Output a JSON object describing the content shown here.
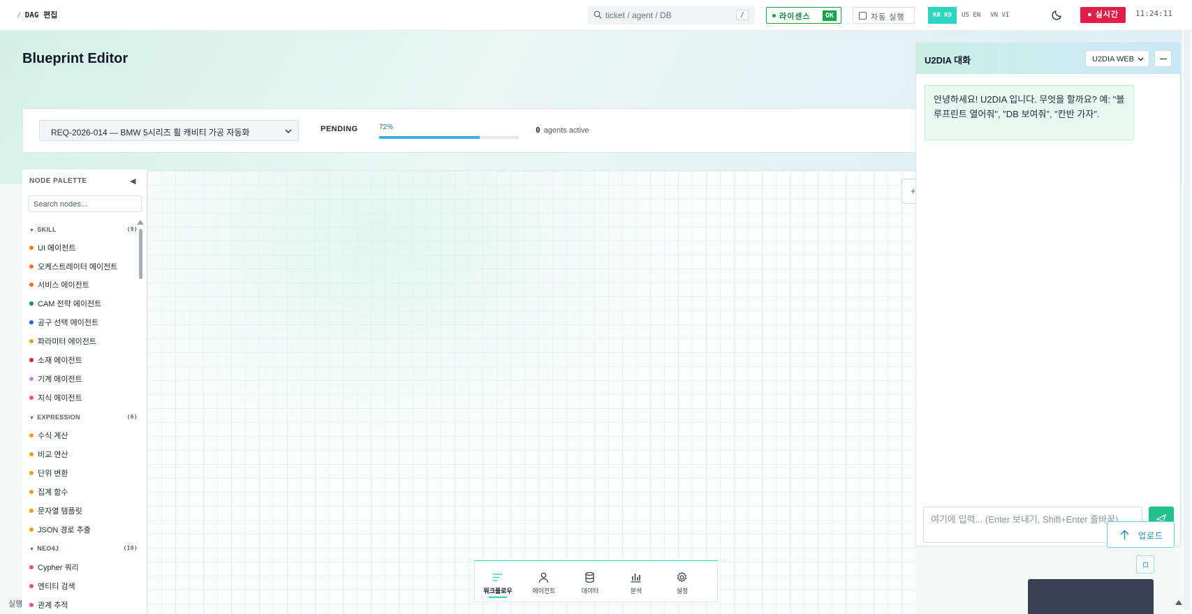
{
  "topbar": {
    "breadcrumb_sep": "/",
    "breadcrumb": "DAG 편집",
    "search_placeholder": "ticket / agent / DB",
    "search_shortcut": "/",
    "license_label": "라이센스",
    "license_status": "OK",
    "autorun_label": "자동 실행",
    "languages": [
      {
        "flag": "KR",
        "code": "KO",
        "active": true
      },
      {
        "flag": "US",
        "code": "EN",
        "active": false
      },
      {
        "flag": "VN",
        "code": "VI",
        "active": false
      }
    ],
    "live_label": "● 실시간",
    "clock": "11:24:11"
  },
  "page": {
    "title": "Blueprint Editor",
    "request_select": "REQ-2026-014 — BMW 5시리즈 휠 캐비티 가공 자동화",
    "status": "PENDING",
    "progress_label": "72%",
    "progress_value": 0.72,
    "agents_count": "0",
    "agents_label": "agents active"
  },
  "palette": {
    "title": "NODE PALETTE",
    "collapse_icon": "◀",
    "search_placeholder": "Search nodes...",
    "sections": [
      {
        "name": "SKILL",
        "count": "(9)",
        "items": [
          {
            "label": "UI 에이전트",
            "color": "#f97316"
          },
          {
            "label": "오케스트레이터 에이전트",
            "color": "#f97316"
          },
          {
            "label": "서비스 에이전트",
            "color": "#f97316"
          },
          {
            "label": "CAM 전략 에이전트",
            "color": "#059669"
          },
          {
            "label": "공구 선택 에이전트",
            "color": "#2563eb"
          },
          {
            "label": "파라미터 에이전트",
            "color": "#f59e0b"
          },
          {
            "label": "소재 에이전트",
            "color": "#dc2626"
          },
          {
            "label": "기계 에이전트",
            "color": "#c084fc"
          },
          {
            "label": "지식 에이전트",
            "color": "#ec4899"
          }
        ]
      },
      {
        "name": "EXPRESSION",
        "count": "(6)",
        "items": [
          {
            "label": "수식 계산",
            "color": "#f59e0b"
          },
          {
            "label": "비교 연산",
            "color": "#f59e0b"
          },
          {
            "label": "단위 변환",
            "color": "#f59e0b"
          },
          {
            "label": "집계 함수",
            "color": "#f59e0b"
          },
          {
            "label": "문자열 템플릿",
            "color": "#f59e0b"
          },
          {
            "label": "JSON 경로 추출",
            "color": "#f59e0b"
          }
        ]
      },
      {
        "name": "NEO4J",
        "count": "(10)",
        "items": [
          {
            "label": "Cypher 쿼리",
            "color": "#ec4899"
          },
          {
            "label": "엔티티 검색",
            "color": "#ec4899"
          },
          {
            "label": "관계 추적",
            "color": "#ec4899"
          }
        ]
      }
    ]
  },
  "footer_stub": "실행",
  "zoom_label": "+",
  "dock": {
    "items": [
      {
        "label": "워크플로우",
        "icon": "workflow-icon",
        "active": true
      },
      {
        "label": "에이전트",
        "icon": "agent-icon",
        "active": false
      },
      {
        "label": "데이터",
        "icon": "database-icon",
        "active": false
      },
      {
        "label": "분석",
        "icon": "chart-icon",
        "active": false
      },
      {
        "label": "설정",
        "icon": "gear-icon",
        "active": false
      }
    ]
  },
  "chat": {
    "title": "U2DIA 대화",
    "mode": "U2DIA WEB",
    "greeting": "안녕하세요! U2DIA 입니다. 무엇을 할까요? 예: \"블루프린트 열어줘\", \"DB 보여줘\", \"칸반 가자\".",
    "input_placeholder": "여기에 입력... (Enter 보내기, Shift+Enter 줄바꿈)",
    "upload_label": "업로드"
  },
  "colors": {
    "accent": "#2dd4bf",
    "live": "#e11d48",
    "license": "#16a34a",
    "progress": "#38aee6",
    "send": "#22c08a"
  }
}
